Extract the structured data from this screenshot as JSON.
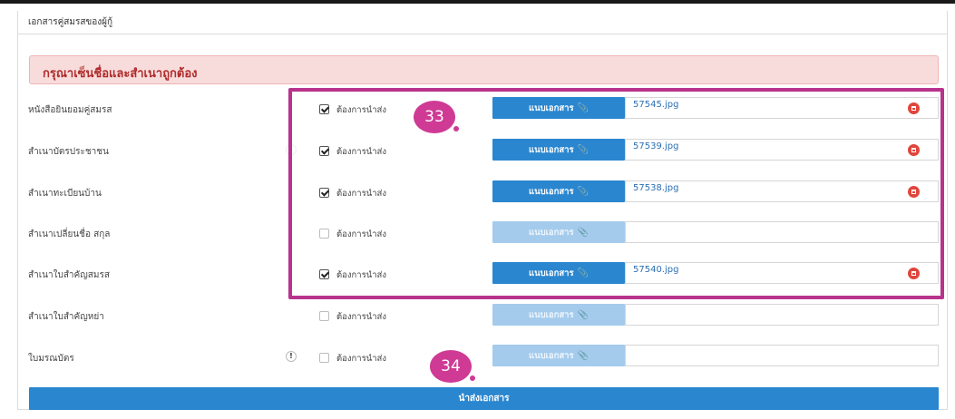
{
  "section": {
    "title": "เอกสารคู่สมรสของผู้กู้"
  },
  "alert": {
    "message": "กรุณาเซ็นชื่อและสำเนาถูกต้อง"
  },
  "check_label": "ต้องการนำส่ง",
  "attach_label": "แนบเอกสาร",
  "rows": [
    {
      "label": "หนังสือยินยอมคู่สมรส",
      "checked": true,
      "file": "57545.jpg"
    },
    {
      "label": "สำเนาบัตรประชาชน",
      "checked": true,
      "file": "57539.jpg"
    },
    {
      "label": "สำเนาทะเบียนบ้าน",
      "checked": true,
      "file": "57538.jpg"
    },
    {
      "label": "สำเนาเปลี่ยนชื่อ สกุล",
      "checked": false,
      "file": ""
    },
    {
      "label": "สำเนาใบสำคัญสมรส",
      "checked": true,
      "file": "57540.jpg"
    },
    {
      "label": "สำเนาใบสำคัญหย่า",
      "checked": false,
      "file": ""
    },
    {
      "label": "ใบมรณบัตร",
      "checked": false,
      "file": "",
      "info": "!"
    }
  ],
  "markers": {
    "m1": "33",
    "m2": "34"
  },
  "submit": {
    "label": "นำส่งเอกสาร"
  },
  "colors": {
    "primary": "#2a86cf",
    "disabled": "#a4cbec",
    "danger": "#e0463c",
    "highlight": "#b8338c",
    "alert_bg": "#f8dcdc",
    "alert_text": "#b02a2a"
  }
}
